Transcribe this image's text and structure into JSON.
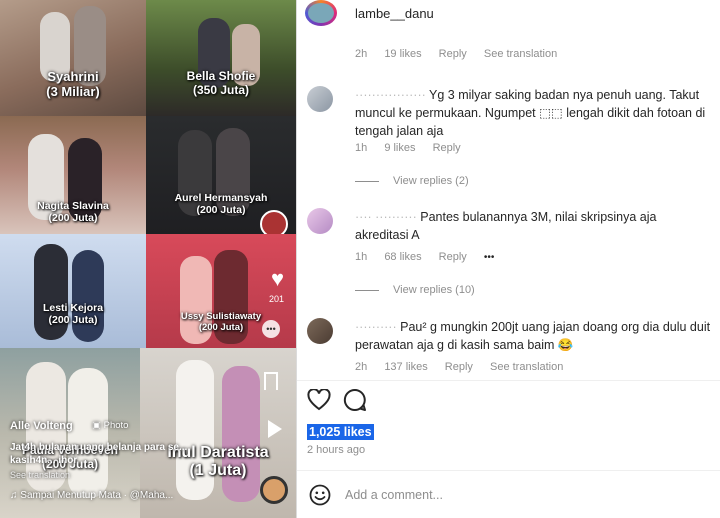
{
  "tiles": [
    {
      "name": "Syahrini",
      "amount": "(3 Miliar)"
    },
    {
      "name": "Bella Shofie",
      "amount": "(350 Juta)"
    },
    {
      "name": "Nagita Slavina",
      "amount": "(200 Juta)"
    },
    {
      "name": "Aurel Hermansyah",
      "amount": "(200 Juta)"
    },
    {
      "name": "Lesti Kejora",
      "amount": "(200 Juta)"
    },
    {
      "name": "Ussy Sulistiawaty",
      "amount": "(200 Juta)"
    },
    {
      "name": "Paula Verhoeven",
      "amount": "(200 Juta)"
    },
    {
      "name": "Inul Daratista",
      "amount": "(1 Juta)"
    }
  ],
  "overlay": {
    "user": "Alle Volteng",
    "photo_label": "Photo",
    "caption": "Jat4h bulanan uang belanja para se... kasih4n... ihor",
    "see_translation": "See translation",
    "music": "Sampai Menutup Mata · @Maha...",
    "like_count": "201"
  },
  "post": {
    "username": "lambe__danu"
  },
  "labels": {
    "reply": "Reply",
    "see_translation": "See translation",
    "view_replies_2": "View replies (2)",
    "view_replies_10": "View replies (10)",
    "more": "•••"
  },
  "first_meta": {
    "time": "2h",
    "likes": "19 likes"
  },
  "comments": [
    {
      "user": "·················",
      "text": "Yg 3 milyar saking badan nya penuh uang. Takut muncul ke permukaan. Ngumpet ⬚⬚ lengah dikit dah fotoan di tengah jalan aja",
      "time": "1h",
      "likes": "9 likes"
    },
    {
      "user": "···· ··········",
      "text": "Pantes bulanannya 3M, nilai skripsinya aja akreditasi A",
      "time": "1h",
      "likes": "68 likes"
    },
    {
      "user": "··········",
      "text": "Pau² g mungkin 200jt uang jajan doang org dia dulu duit perawatan aja g di kasih sama baim 😂",
      "time": "2h",
      "likes": "137 likes"
    }
  ],
  "footer": {
    "likes": "1,025 likes",
    "ago": "2 hours ago",
    "add_comment_placeholder": "Add a comment..."
  },
  "colors": {
    "accent": "#1a66e8",
    "muted": "#8e8e8e",
    "text": "#262626"
  }
}
